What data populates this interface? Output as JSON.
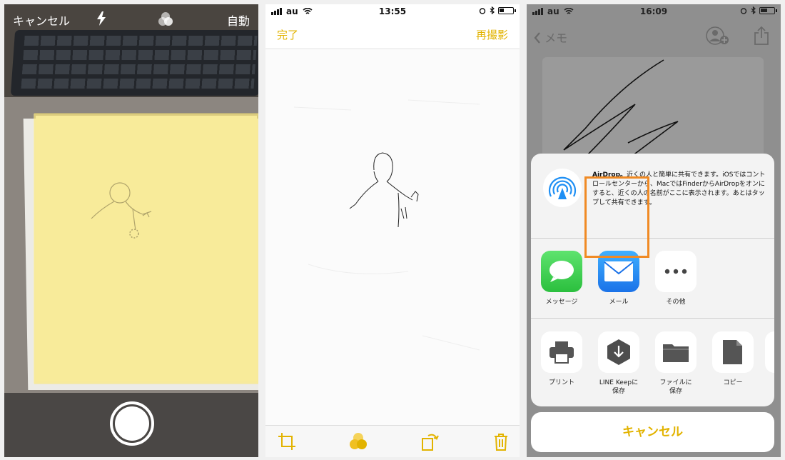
{
  "panel_camera": {
    "cancel_label": "キャンセル",
    "flash_icon": "flash-icon",
    "filter_icon": "filter-icon",
    "mode_label": "自動",
    "shutter_icon": "shutter-button"
  },
  "panel_scan": {
    "status": {
      "carrier": "au",
      "time": "13:55",
      "battery": 0.35
    },
    "done_label": "完了",
    "retake_label": "再撮影",
    "toolbar_icons": [
      "crop-icon",
      "filter-icon",
      "rotate-icon",
      "trash-icon"
    ],
    "accent_color": "#e2b300"
  },
  "panel_share": {
    "status": {
      "carrier": "au",
      "time": "16:09",
      "battery": 0.55
    },
    "back_label": "メモ",
    "airdrop": {
      "title": "AirDrop。",
      "text": "近くの人と簡単に共有できます。iOSではコントロールセンターから、MacではFinderからAirDropをオンにすると、近くの人の名前がここに表示されます。あとはタップして共有できます。"
    },
    "apps": [
      {
        "label": "メッセージ",
        "icon": "messages-icon",
        "color": "#35c759"
      },
      {
        "label": "メール",
        "icon": "mail-icon",
        "color": "#1e8ff4"
      },
      {
        "label": "その他",
        "icon": "more-icon",
        "color": "#ffffff"
      }
    ],
    "actions": [
      {
        "label": "プリント",
        "icon": "print-icon"
      },
      {
        "label": "LINE Keepに\n保存",
        "icon": "line-keep-icon"
      },
      {
        "label": "ファイルに\n保存",
        "icon": "folder-icon"
      },
      {
        "label": "コピー",
        "icon": "copy-icon"
      }
    ],
    "cancel_label": "キャンセル",
    "highlight_color": "#f08a24"
  }
}
